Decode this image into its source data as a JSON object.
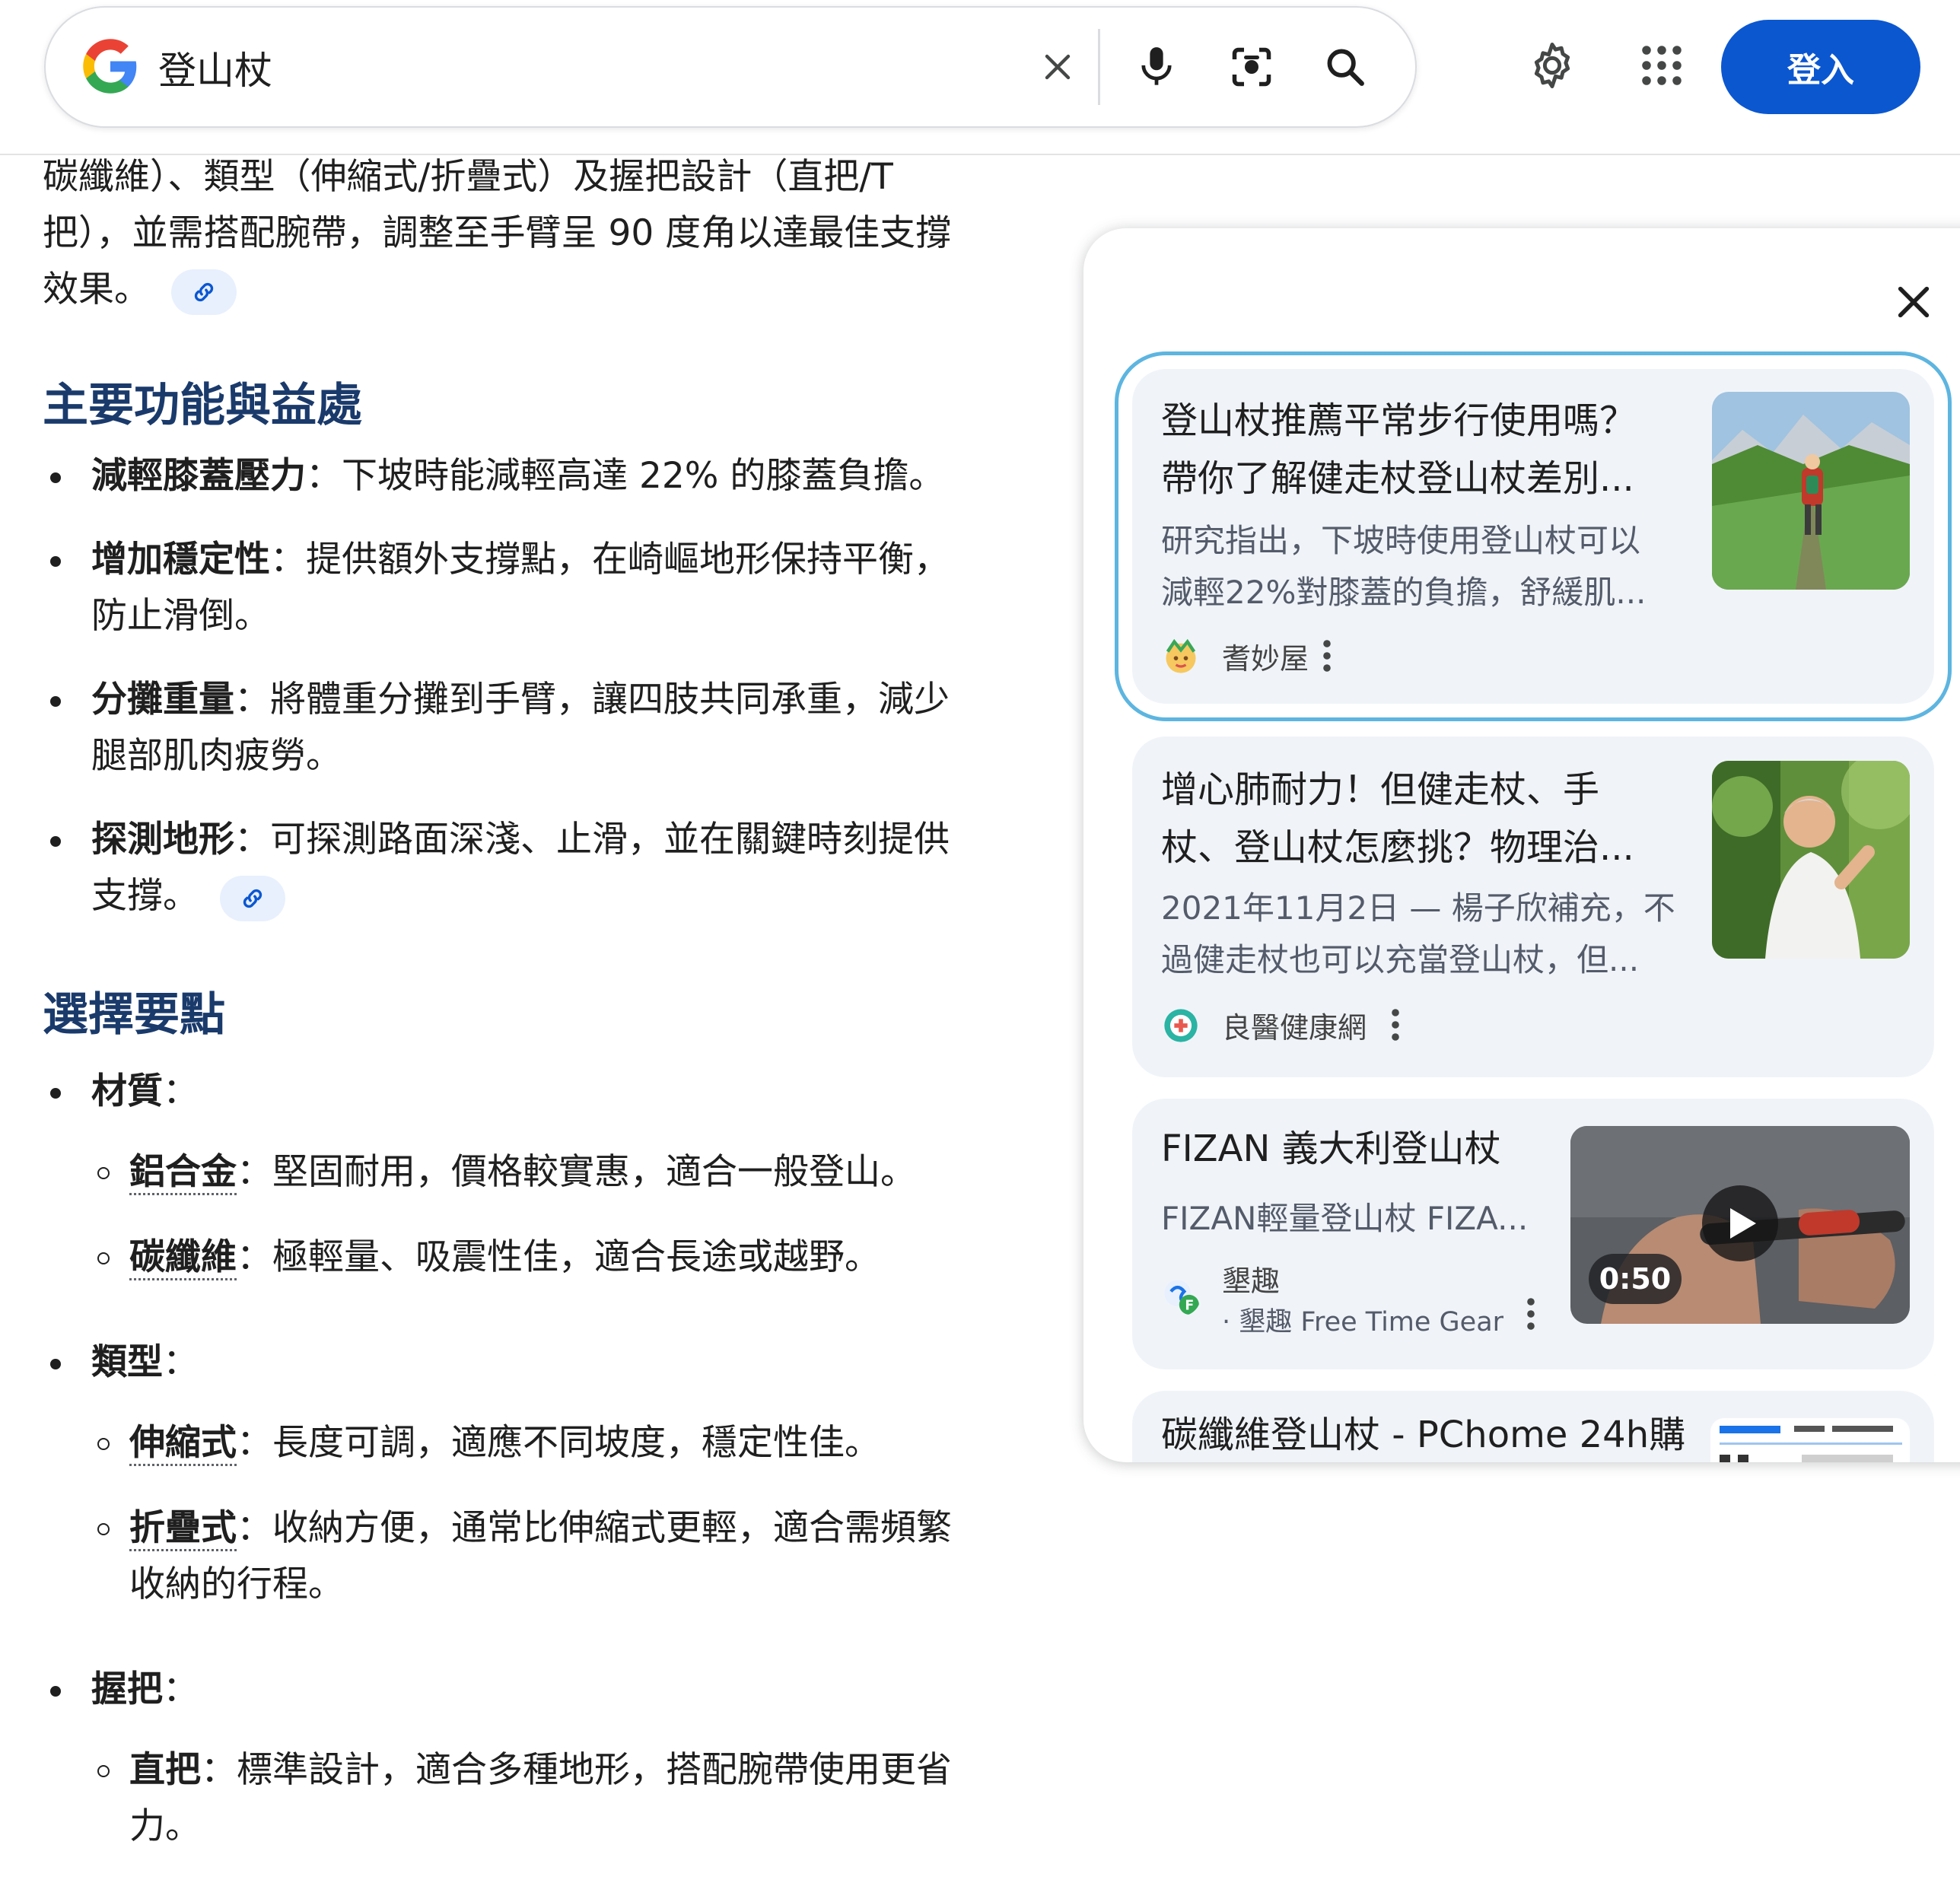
{
  "search": {
    "query": "登山杖",
    "sign_in_label": "登入",
    "icons": {
      "logo": "google-g-logo",
      "clear": "close-icon",
      "voice": "microphone-icon",
      "lens": "camera-lens-icon",
      "search": "search-icon",
      "settings": "gear-icon",
      "apps": "apps-grid-icon"
    }
  },
  "overview": {
    "intro_line1": "碳纖維）、類型（伸縮式/折疊式）及握把設計（直把/T",
    "intro_line2": "把），並需搭配腕帶，調整至手臂呈 90 度角以達最佳支撐",
    "intro_line3": "效果。",
    "section1_title": "主要功能與益處",
    "benefits": [
      {
        "term": "減輕膝蓋壓力",
        "text": "：下坡時能減輕高達 22% 的膝蓋負擔。"
      },
      {
        "term": "增加穩定性",
        "text": "：提供額外支撐點，在崎嶇地形保持平衡，",
        "text2": "防止滑倒。"
      },
      {
        "term": "分攤重量",
        "text": "：將體重分攤到手臂，讓四肢共同承重，減少",
        "text2": "腿部肌肉疲勞。"
      },
      {
        "term": "探測地形",
        "text": "：可探測路面深淺、止滑，並在關鍵時刻提供",
        "text2": "支撐。"
      }
    ],
    "section2_title": "選擇要點",
    "material": {
      "label": "材質",
      "colon": "：",
      "items": [
        {
          "term": "鋁合金",
          "text": "：堅固耐用，價格較實惠，適合一般登山。"
        },
        {
          "term": "碳纖維",
          "text": "：極輕量、吸震性佳，適合長途或越野。"
        }
      ]
    },
    "type": {
      "label": "類型",
      "colon": "：",
      "items": [
        {
          "term": "伸縮式",
          "text": "：長度可調，適應不同坡度，穩定性佳。"
        },
        {
          "term": "折疊式",
          "text": "：收納方便，通常比伸縮式更輕，適合需頻繁",
          "text2": "收納的行程。"
        }
      ]
    },
    "grip": {
      "label": "握把",
      "colon": "：",
      "items": [
        {
          "term": "直把",
          "text": "：標準設計，適合多種地形，搭配腕帶使用更省",
          "text2": "力。"
        }
      ]
    }
  },
  "sources": {
    "cards": [
      {
        "title1": "登山杖推薦平常步行使用嗎？",
        "title2": "帶你了解健走杖登山杖差別...",
        "snippet1": "研究指出，下坡時使用登山杖可以",
        "snippet2": "減輕22%對膝蓋的負擔，舒緩肌...",
        "source": "耆妙屋",
        "thumbnail": "hiker-on-mountain-trail-photo"
      },
      {
        "title1": "增心肺耐力！但健走杖、手",
        "title2": "杖、登山杖怎麼挑？物理治...",
        "snippet1": "2021年11月2日 — 楊子欣補充，不",
        "snippet2": "過健走杖也可以充當登山杖，但...",
        "source": "良醫健康網",
        "thumbnail": "man-walking-outdoors-photo"
      },
      {
        "title1": "FIZAN 義大利登山杖",
        "snippet1": "FIZAN輕量登山杖 FIZA...",
        "source": "墾趣",
        "source_sub": "· 墾趣 Free Time Gear",
        "duration": "0:50",
        "thumbnail": "video-thumbnail-hands-holding-pole"
      },
      {
        "title1": "碳纖維登山杖 - PChome 24h購",
        "thumbnail": "product-listing-thumbnail"
      }
    ]
  },
  "colors": {
    "accent": "#0b57d0",
    "heading": "#1a3a6b",
    "card_bg": "#f0f4f9",
    "active_outline": "#5db5e0"
  }
}
